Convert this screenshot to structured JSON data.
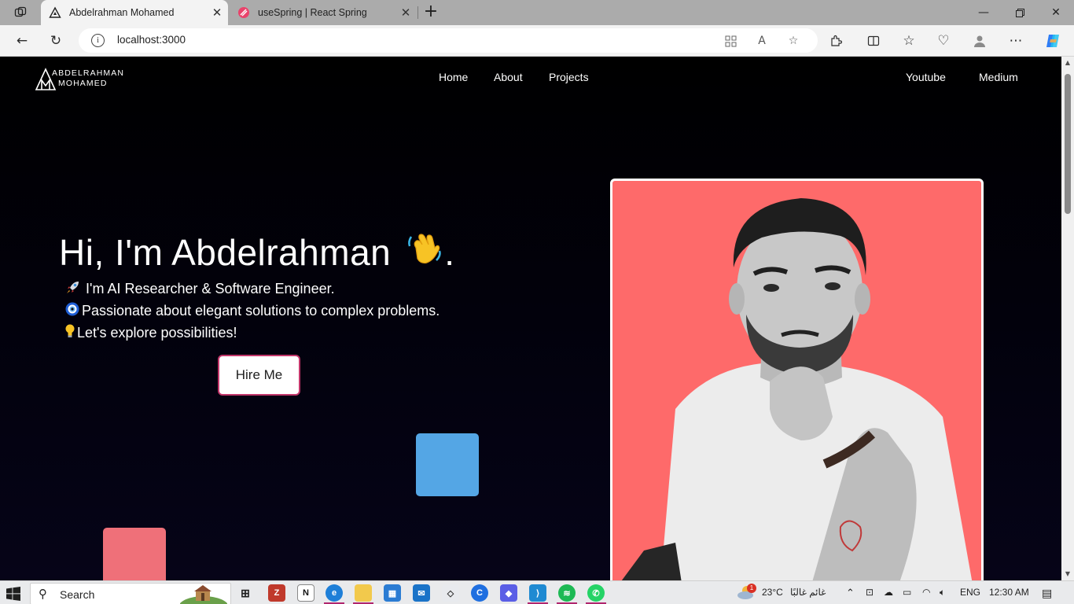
{
  "browser": {
    "tabs": [
      {
        "title": "Abdelrahman Mohamed",
        "active": true
      },
      {
        "title": "useSpring | React Spring",
        "active": false
      }
    ],
    "url": "localhost:3000"
  },
  "site": {
    "logo": {
      "line1": "ABDELRAHMAN",
      "line2": "MOHAMED"
    },
    "nav_center": [
      "Home",
      "About",
      "Projects"
    ],
    "nav_right": [
      "Youtube",
      "Medium"
    ],
    "hero": {
      "title": "Hi, I'm Abdelrahman",
      "title_suffix": ".",
      "lines": [
        "I'm AI Researcher & Software Engineer.",
        "Passionate about elegant solutions to complex problems.",
        "Let's explore possibilities!"
      ],
      "hire_label": "Hire Me"
    },
    "colors": {
      "accent_blue": "#54a6e5",
      "accent_pink": "#ef7079",
      "photo_bg": "#fe6a6a",
      "button_border": "#c2366a"
    }
  },
  "taskbar": {
    "search_label": "Search",
    "weather": {
      "temp": "23°C",
      "condition": "غائم غالبًا",
      "badge": "1"
    },
    "language": "ENG",
    "time": "12:30 AM"
  }
}
